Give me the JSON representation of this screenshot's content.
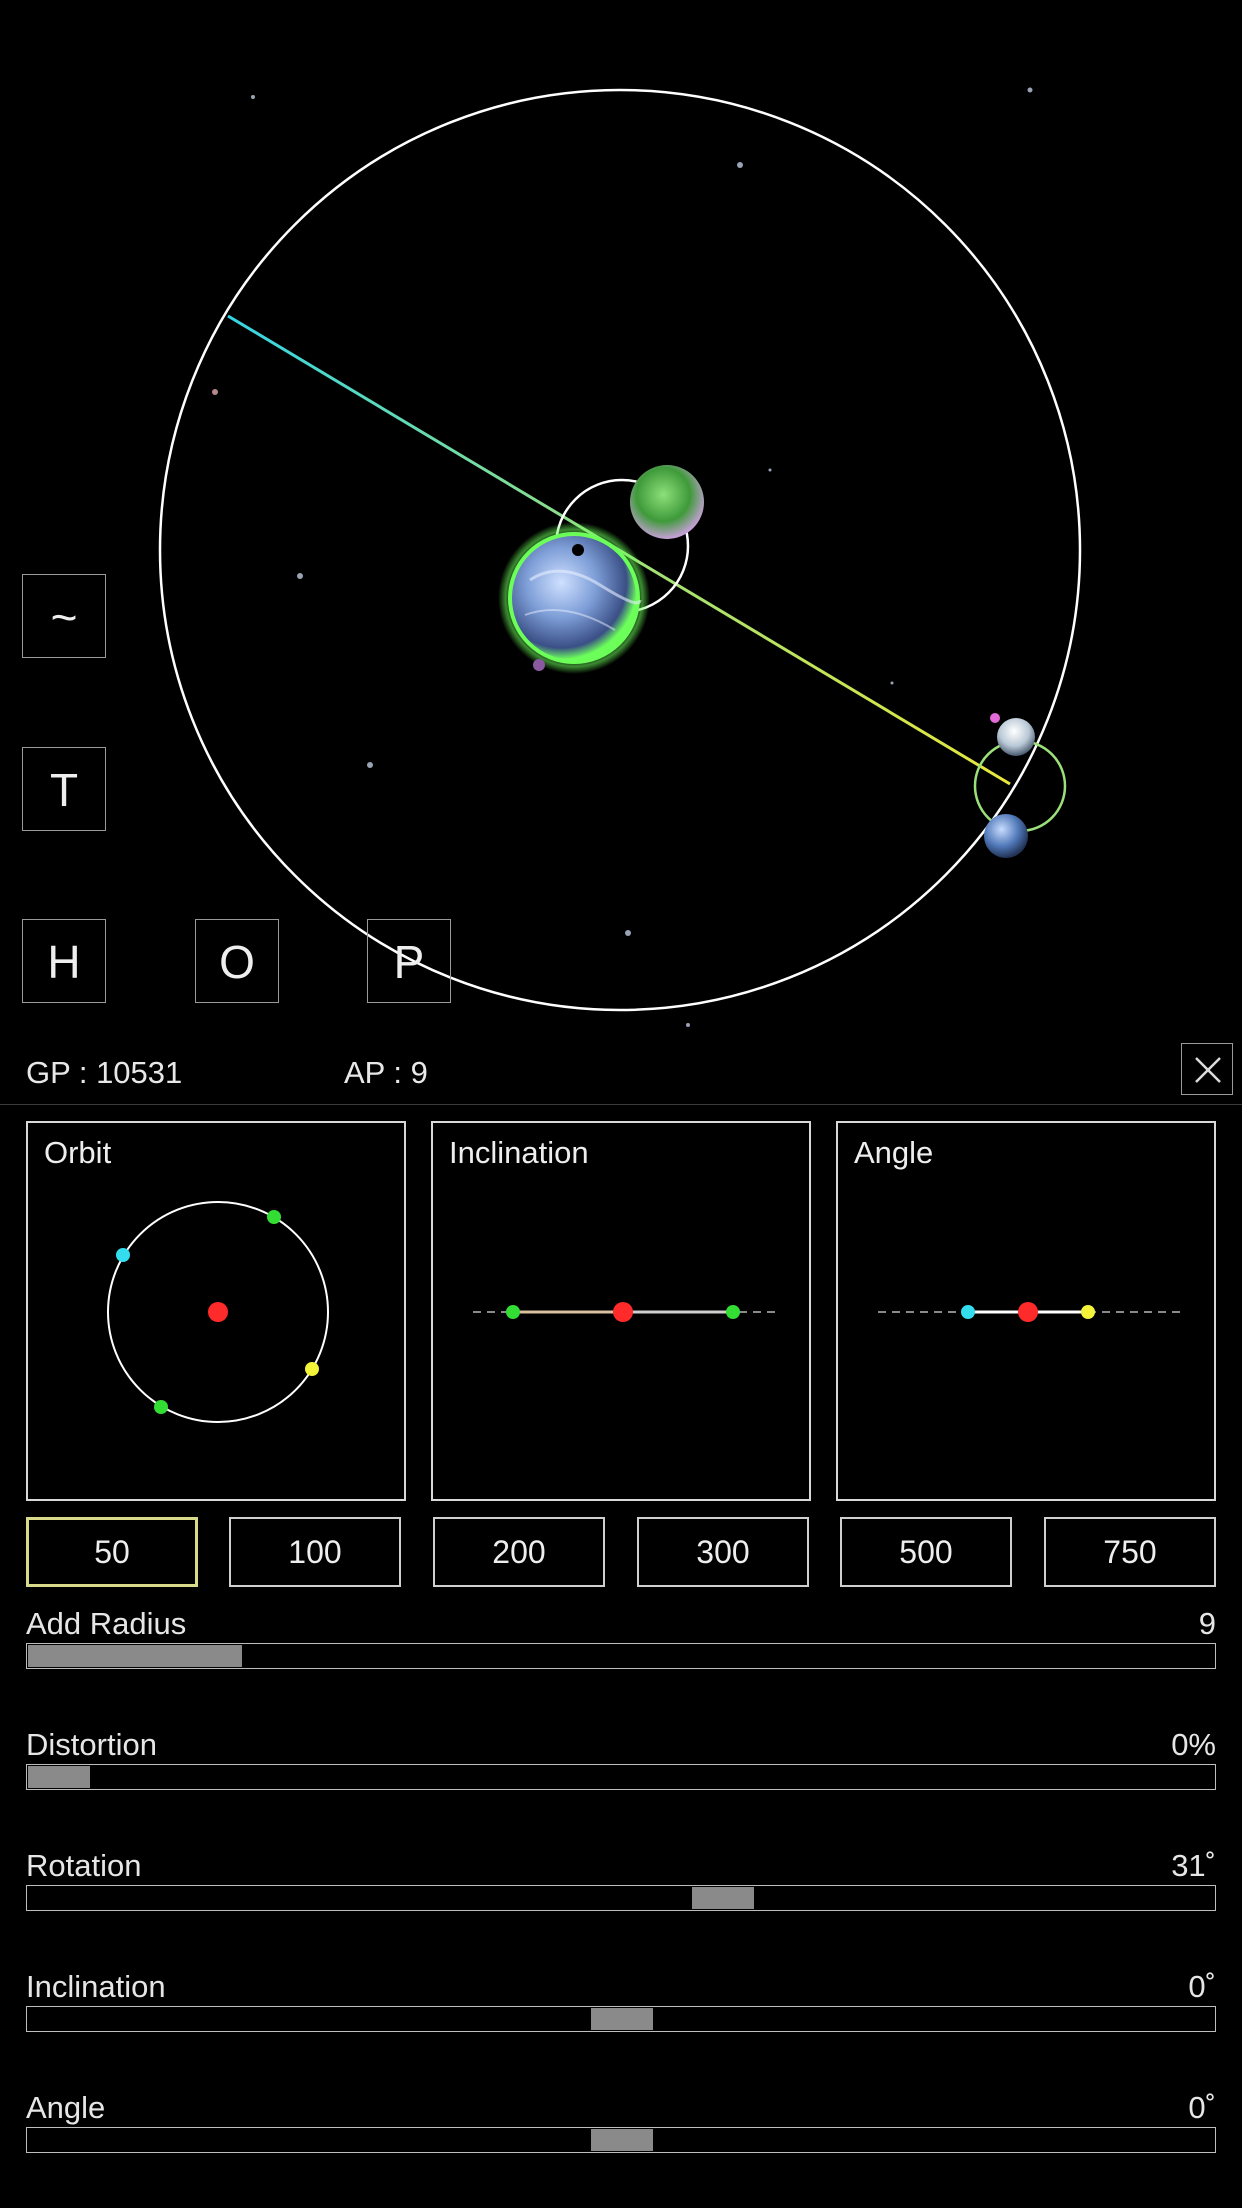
{
  "mode_buttons": [
    {
      "key": "wave",
      "label": "~"
    },
    {
      "key": "t",
      "label": "T"
    },
    {
      "key": "h",
      "label": "H"
    },
    {
      "key": "o",
      "label": "O"
    },
    {
      "key": "p",
      "label": "P"
    }
  ],
  "stats": {
    "gp": "GP : 10531",
    "ap": "AP : 9"
  },
  "close_icon": "close-icon",
  "panels": {
    "orbit": {
      "title": "Orbit"
    },
    "inclination": {
      "title": "Inclination"
    },
    "angle": {
      "title": "Angle"
    }
  },
  "amounts": [
    {
      "label": "50",
      "selected": true
    },
    {
      "label": "100",
      "selected": false
    },
    {
      "label": "200",
      "selected": false
    },
    {
      "label": "300",
      "selected": false
    },
    {
      "label": "500",
      "selected": false
    },
    {
      "label": "750",
      "selected": false
    }
  ],
  "sliders": [
    {
      "key": "add_radius",
      "label": "Add Radius",
      "value": "9",
      "level": 0.18,
      "style": "fill"
    },
    {
      "key": "distortion",
      "label": "Distortion",
      "value": "0%",
      "level": 0.0,
      "style": "fill"
    },
    {
      "key": "rotation",
      "label": "Rotation",
      "value": "31˚",
      "level": 0.585,
      "style": "thumb"
    },
    {
      "key": "inclination",
      "label": "Inclination",
      "value": "0˚",
      "level": 0.5,
      "style": "thumb"
    },
    {
      "key": "angle",
      "label": "Angle",
      "value": "0˚",
      "level": 0.5,
      "style": "thumb"
    }
  ],
  "colors": {
    "planet_main": "#7f9fd8",
    "planet_glow": "#6cff5a",
    "moon": "#3f9a3a",
    "orbit_line": "#ffffff",
    "axis_cyan": "#33d6e6",
    "axis_yellow": "#e8e83a",
    "marker_red": "#ff2a2a",
    "marker_green": "#33dd33",
    "marker_cyan": "#33ddee",
    "marker_yellow": "#f3f33a",
    "selected_border": "#d9d98a"
  }
}
